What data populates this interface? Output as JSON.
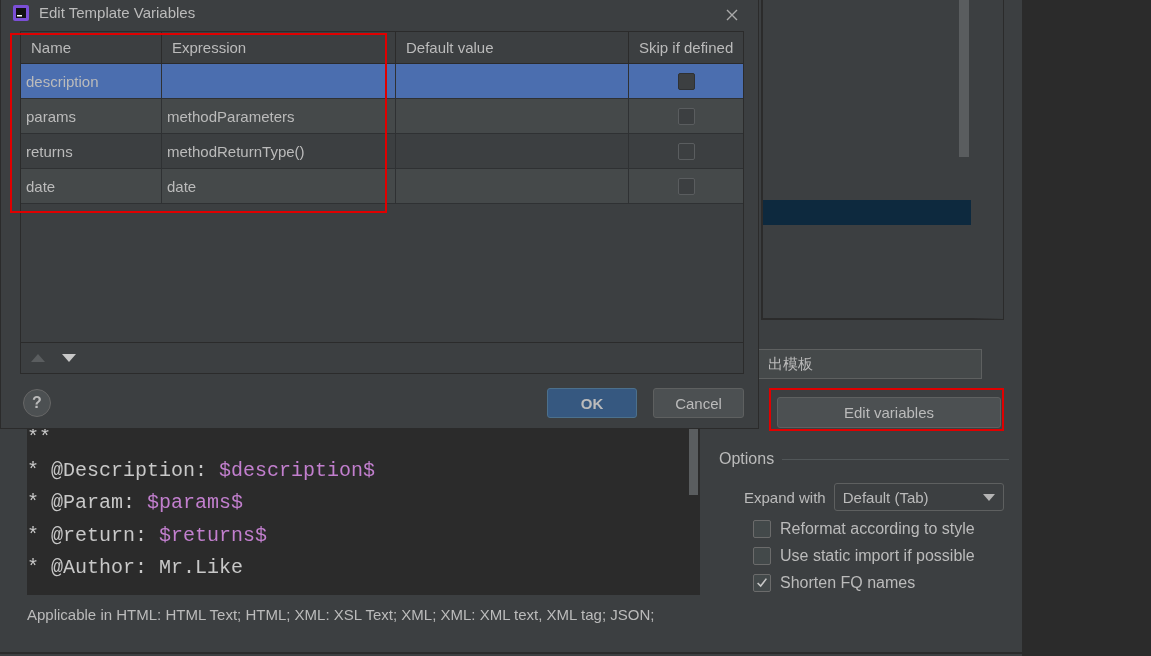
{
  "dialog": {
    "title": "Edit Template Variables",
    "columns": [
      "Name",
      "Expression",
      "Default value",
      "Skip if defined"
    ],
    "rows": [
      {
        "name": "description",
        "skip_if_defined": false,
        "selected": true
      },
      {
        "name": "params",
        "expression": "methodParameters",
        "skip_if_defined": false,
        "selected": false
      },
      {
        "name": "returns",
        "expression": "methodReturnType()",
        "skip_if_defined": false,
        "selected": false
      },
      {
        "name": "date",
        "expression": "date",
        "skip_if_defined": false,
        "selected": false
      }
    ],
    "move_up": {
      "disabled": true
    },
    "move_down": {
      "disabled": false
    },
    "help": "?",
    "buttons": [
      {
        "label": "OK",
        "kind": "default"
      },
      {
        "label": "Cancel",
        "kind": "normal"
      }
    ]
  },
  "template_text": [
    [
      {
        "kind": "plain",
        "text": "**"
      }
    ],
    [
      {
        "kind": "plain",
        "text": "* @Description: "
      },
      {
        "kind": "variable",
        "text": "$description$"
      }
    ],
    [
      {
        "kind": "plain",
        "text": "* @Param: "
      },
      {
        "kind": "variable",
        "text": "$params$"
      }
    ],
    [
      {
        "kind": "plain",
        "text": "* @return: "
      },
      {
        "kind": "variable",
        "text": "$returns$"
      }
    ],
    [
      {
        "kind": "plain",
        "text": "* @Author: Mr.Like"
      }
    ]
  ],
  "applicable": "Applicable in HTML: HTML Text; HTML; XML: XSL Text; XML; XML: XML text, XML tag; JSON;",
  "description_field": {
    "value": "出模板"
  },
  "edit_variables_button": "Edit variables",
  "options": {
    "title": "Options",
    "expand_with": {
      "label": "Expand with",
      "value": "Default (Tab)"
    },
    "checkboxes": [
      {
        "label": "Reformat according to style",
        "checked": false
      },
      {
        "label": "Use static import if possible",
        "checked": false
      },
      {
        "label": "Shorten FQ names",
        "checked": true
      }
    ]
  }
}
